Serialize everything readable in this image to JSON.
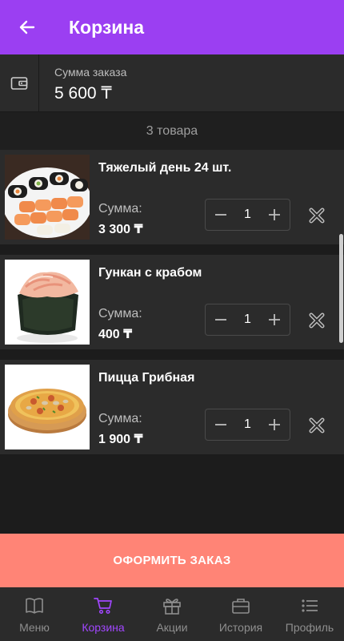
{
  "appbar": {
    "title": "Корзина"
  },
  "summary": {
    "label": "Сумма заказа",
    "value": "5 600 ₸"
  },
  "count_text": "3 товара",
  "items": [
    {
      "name": "Тяжелый день 24 шт.",
      "sum_label": "Сумма:",
      "sum_value": "3 300 ₸",
      "qty": "1"
    },
    {
      "name": "Гункан с крабом",
      "sum_label": "Сумма:",
      "sum_value": "400 ₸",
      "qty": "1"
    },
    {
      "name": "Пицца Грибная",
      "sum_label": "Сумма:",
      "sum_value": "1 900 ₸",
      "qty": "1"
    }
  ],
  "checkout_label": "ОФОРМИТЬ ЗАКАЗ",
  "nav": [
    {
      "label": "Меню",
      "icon": "book-icon"
    },
    {
      "label": "Корзина",
      "icon": "cart-icon"
    },
    {
      "label": "Акции",
      "icon": "gift-icon"
    },
    {
      "label": "История",
      "icon": "briefcase-icon"
    },
    {
      "label": "Профиль",
      "icon": "list-icon"
    }
  ],
  "colors": {
    "accent": "#9b3ff2",
    "checkout": "#ff8476",
    "nav_active": "#a147ff"
  }
}
